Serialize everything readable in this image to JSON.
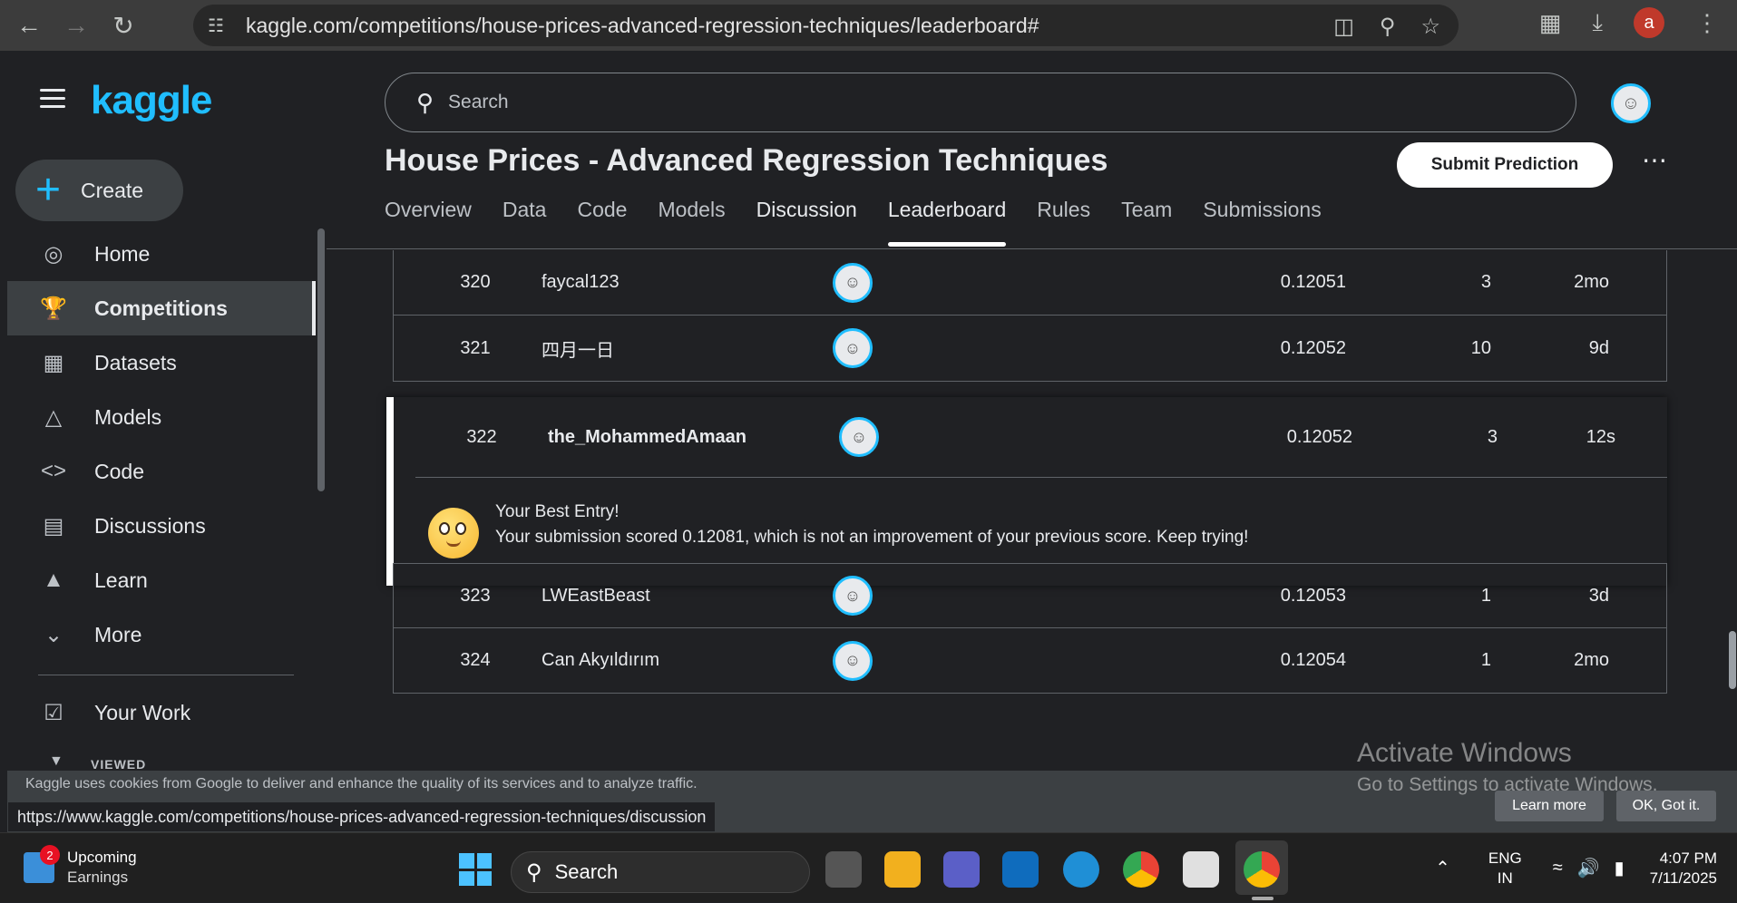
{
  "browser": {
    "url": "kaggle.com/competitions/house-prices-advanced-regression-techniques/leaderboard#",
    "profile_initial": "a"
  },
  "sidebar": {
    "logo": "kaggle",
    "create_label": "Create",
    "items": [
      {
        "label": "Home",
        "icon": "compass-icon"
      },
      {
        "label": "Competitions",
        "icon": "trophy-icon",
        "active": true
      },
      {
        "label": "Datasets",
        "icon": "table-icon"
      },
      {
        "label": "Models",
        "icon": "models-icon"
      },
      {
        "label": "Code",
        "icon": "code-icon"
      },
      {
        "label": "Discussions",
        "icon": "discussion-icon"
      },
      {
        "label": "Learn",
        "icon": "learn-icon"
      },
      {
        "label": "More",
        "icon": "chevron-down-icon"
      }
    ],
    "your_work": "Your Work",
    "viewed": "VIEWED"
  },
  "search": {
    "placeholder": "Search"
  },
  "competition": {
    "title": "House Prices - Advanced Regression Techniques",
    "submit_label": "Submit Prediction",
    "tabs": [
      "Overview",
      "Data",
      "Code",
      "Models",
      "Discussion",
      "Leaderboard",
      "Rules",
      "Team",
      "Submissions"
    ],
    "active_tab": "Leaderboard"
  },
  "leaderboard": {
    "rows_before": [
      {
        "rank": "320",
        "team": "faycal123",
        "score": "0.12051",
        "entries": "3",
        "last": "2mo"
      },
      {
        "rank": "321",
        "team": "四月一日",
        "score": "0.12052",
        "entries": "10",
        "last": "9d"
      }
    ],
    "my_row": {
      "rank": "322",
      "team": "the_MohammedAmaan",
      "score": "0.12052",
      "entries": "3",
      "last": "12s"
    },
    "best_entry_title": "Your Best Entry!",
    "best_entry_message": "Your submission scored 0.12081, which is not an improvement of your previous score. Keep trying!",
    "rows_after": [
      {
        "rank": "323",
        "team": "LWEastBeast",
        "score": "0.12053",
        "entries": "1",
        "last": "3d"
      },
      {
        "rank": "324",
        "team": "Can Akyıldırım",
        "score": "0.12054",
        "entries": "1",
        "last": "2mo"
      }
    ]
  },
  "cookie_banner": {
    "text": "Kaggle uses cookies from Google to deliver and enhance the quality of its services and to analyze traffic.",
    "learn_more": "Learn more",
    "ok": "OK, Got it."
  },
  "status_url": "https://www.kaggle.com/competitions/house-prices-advanced-regression-techniques/discussion",
  "watermark": {
    "line1": "Activate Windows",
    "line2": "Go to Settings to activate Windows."
  },
  "taskbar": {
    "weather_badge": "2",
    "weather_title": "Upcoming",
    "weather_sub": "Earnings",
    "search_label": "Search",
    "lang1": "ENG",
    "lang2": "IN",
    "time": "4:07 PM",
    "date": "7/11/2025"
  }
}
